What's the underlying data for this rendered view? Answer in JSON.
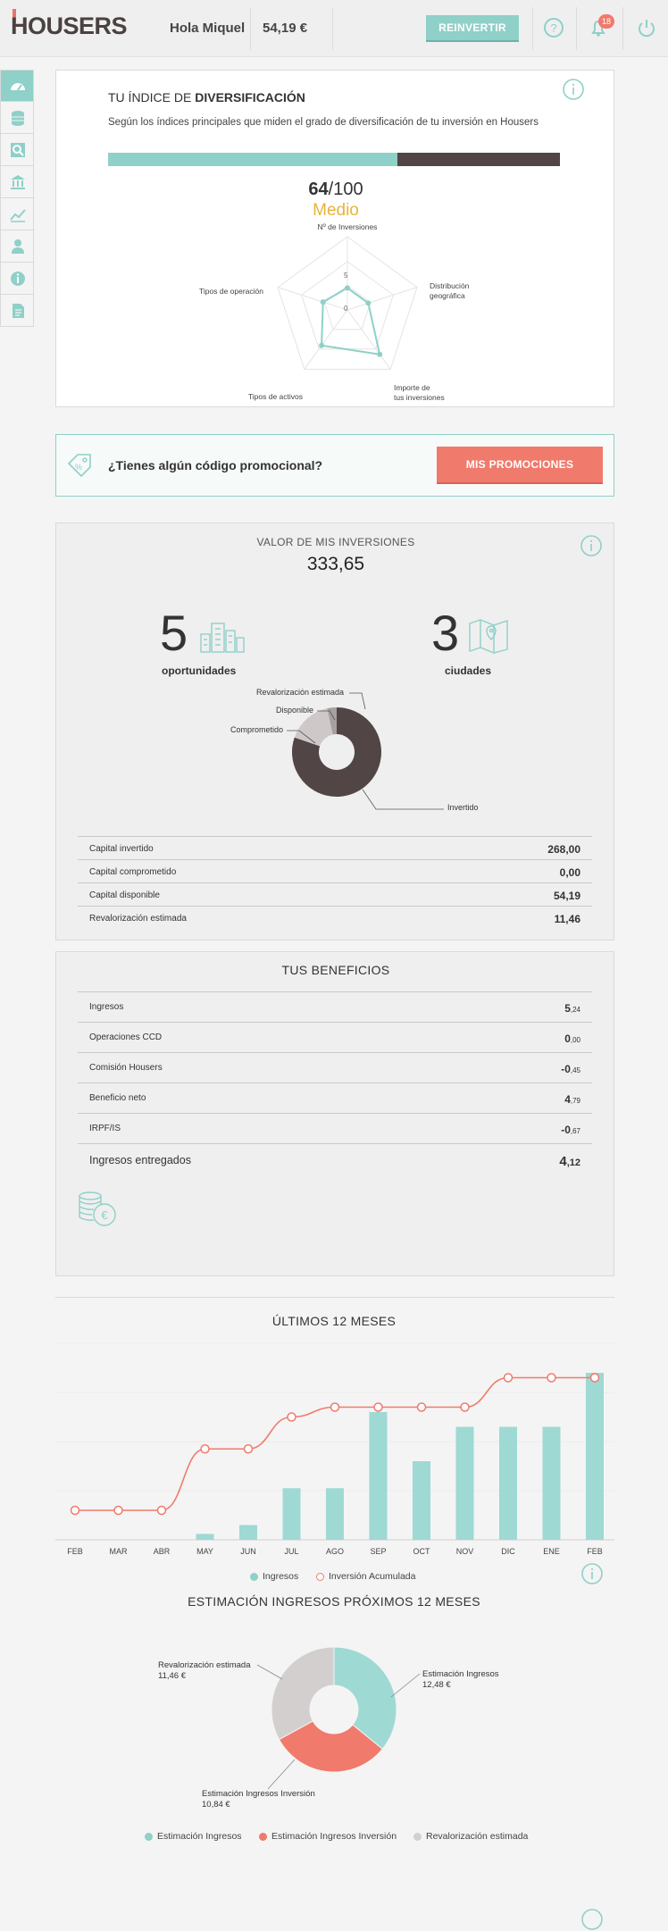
{
  "header": {
    "logo": "HOUSERS",
    "greeting": "Hola Miquel",
    "balance": "54,19 €",
    "reinvest_label": "REINVERTIR",
    "notifications_count": "18"
  },
  "sidebar": {
    "items": [
      "dashboard-icon",
      "database-icon",
      "search-icon",
      "bank-icon",
      "chart-icon",
      "user-icon",
      "info-icon",
      "document-icon"
    ]
  },
  "diversification": {
    "title_prefix": "TU ÍNDICE DE",
    "title_bold": "DIVERSIFICACIÓN",
    "description": "Según los índices principales que miden el grado de diversificación de tu inversión en Housers",
    "score": "64",
    "score_max": "/100",
    "level": "Medio",
    "progress": 0.64,
    "radar": {
      "axes": [
        "Nº de Inversiones",
        "Distribución geográfica",
        "Importe de tus inversiones",
        "Tipos de activos",
        "Tipos de operación"
      ],
      "values": [
        3,
        3,
        7.5,
        6,
        3.5
      ],
      "max": 10,
      "ticks": [
        "5",
        "0"
      ]
    }
  },
  "promo": {
    "question": "¿Tienes algún código promocional?",
    "button": "MIS PROMOCIONES"
  },
  "investments": {
    "title": "VALOR DE MIS INVERSIONES",
    "total": "333,65",
    "opportunities_count": "5",
    "opportunities_label": "oportunidades",
    "cities_count": "3",
    "cities_label": "ciudades",
    "donut": {
      "slices": [
        {
          "label": "Invertido",
          "value": 268.0,
          "color": "#514545"
        },
        {
          "label": "Comprometido",
          "value": 0.0,
          "color": "#8fd0c8"
        },
        {
          "label": "Disponible",
          "value": 54.19,
          "color": "#cfc8c8"
        },
        {
          "label": "Revalorización estimada",
          "value": 11.46,
          "color": "#a8a0a0"
        }
      ]
    },
    "rows": [
      {
        "label": "Capital invertido",
        "value": "268,00"
      },
      {
        "label": "Capital comprometido",
        "value": "0,00"
      },
      {
        "label": "Capital disponible",
        "value": "54,19"
      },
      {
        "label": "Revalorización estimada",
        "value": "11,46"
      }
    ]
  },
  "benefits": {
    "title": "TUS BENEFICIOS",
    "rows": [
      {
        "label": "Ingresos",
        "int": "5",
        "dec": ",24"
      },
      {
        "label": "Operaciones CCD",
        "int": "0",
        "dec": ",00"
      },
      {
        "label": "Comisión Housers",
        "int": "-0",
        "dec": ",45"
      },
      {
        "label": "Beneficio neto",
        "int": "4",
        "dec": ",79"
      },
      {
        "label": "IRPF/IS",
        "int": "-0",
        "dec": ",67"
      }
    ],
    "total": {
      "label": "Ingresos entregados",
      "int": "4",
      "dec": ",12"
    }
  },
  "chart_data": [
    {
      "type": "bar",
      "title": "ÚLTIMOS 12 MESES",
      "categories": [
        "FEB",
        "MAR",
        "ABR",
        "MAY",
        "JUN",
        "JUL",
        "AGO",
        "SEP",
        "OCT",
        "NOV",
        "DIC",
        "ENE",
        "FEB"
      ],
      "series": [
        {
          "name": "Ingresos",
          "kind": "bar",
          "color": "#9fd9d3",
          "values": [
            0,
            0,
            0,
            0.12,
            0.3,
            1.05,
            1.05,
            2.6,
            1.6,
            2.3,
            2.3,
            2.3,
            3.4
          ]
        },
        {
          "name": "Inversión Acumulada",
          "kind": "line",
          "color": "#f07a6c",
          "values": [
            0.6,
            0.6,
            0.6,
            1.85,
            1.85,
            2.5,
            2.7,
            2.7,
            2.7,
            2.7,
            3.3,
            3.3,
            3.3
          ]
        }
      ],
      "ylim": [
        0,
        4
      ],
      "grid": true
    },
    {
      "type": "pie",
      "title": "ESTIMACIÓN INGRESOS PRÓXIMOS 12 MESES",
      "slices": [
        {
          "label": "Estimación Ingresos",
          "value": 12.48,
          "value_label": "12,48 €",
          "color": "#9fd9d3"
        },
        {
          "label": "Estimación Ingresos Inversión",
          "value": 10.84,
          "value_label": "10,84 €",
          "color": "#f07a6c"
        },
        {
          "label": "Revalorización estimada",
          "value": 11.46,
          "value_label": "11,46 €",
          "color": "#d4cfcf"
        }
      ]
    }
  ]
}
